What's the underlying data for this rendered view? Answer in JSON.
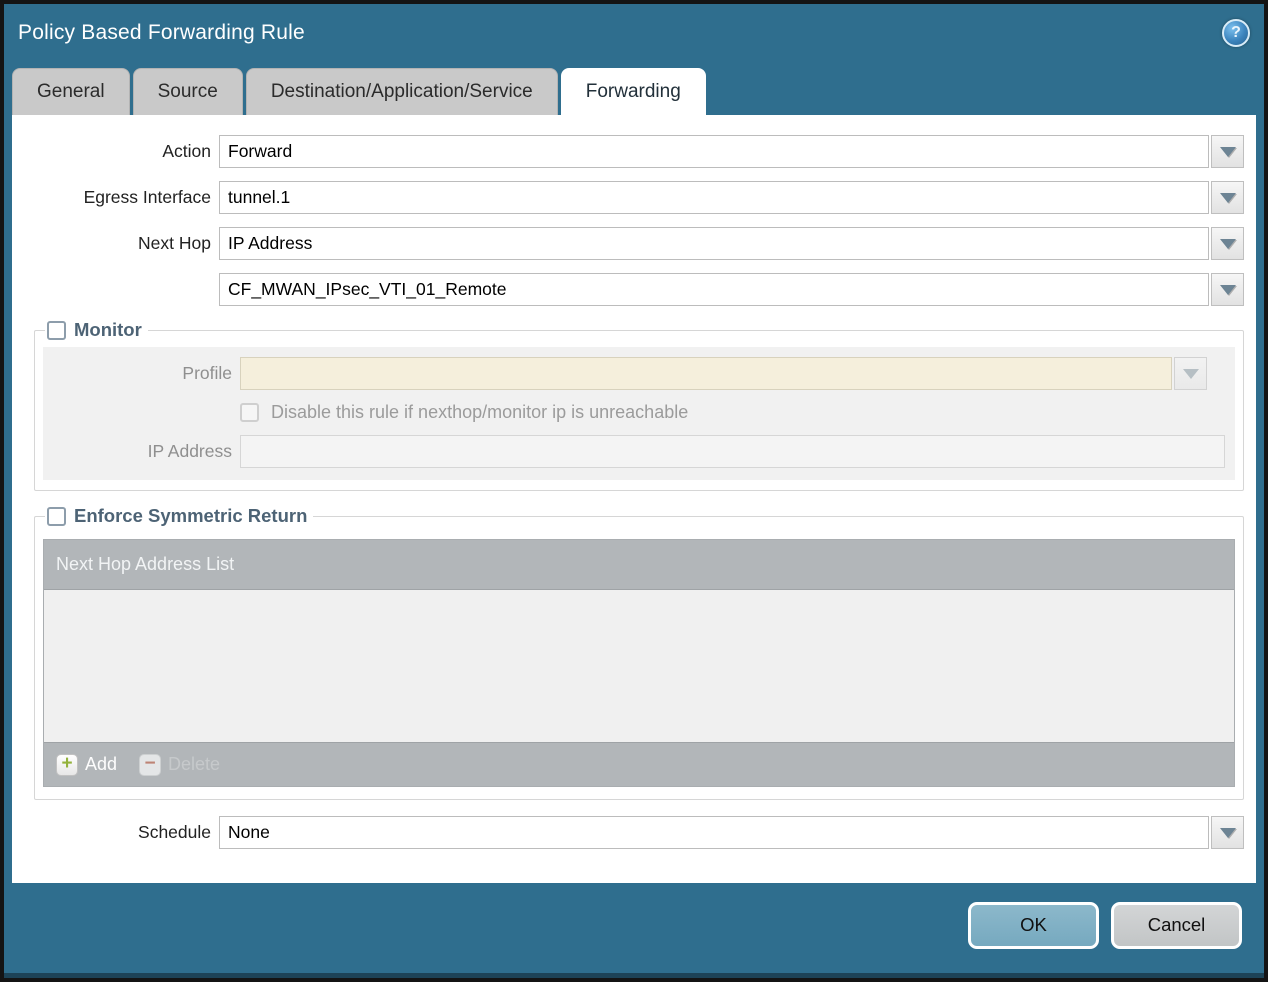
{
  "dialog": {
    "title": "Policy Based Forwarding Rule",
    "help_icon": "?"
  },
  "tabs": [
    {
      "label": "General",
      "active": false
    },
    {
      "label": "Source",
      "active": false
    },
    {
      "label": "Destination/Application/Service",
      "active": false
    },
    {
      "label": "Forwarding",
      "active": true
    }
  ],
  "form": {
    "action": {
      "label": "Action",
      "value": "Forward"
    },
    "egress_interface": {
      "label": "Egress Interface",
      "value": "tunnel.1"
    },
    "next_hop": {
      "label": "Next Hop",
      "type_value": "IP Address",
      "address_value": "CF_MWAN_IPsec_VTI_01_Remote"
    },
    "schedule": {
      "label": "Schedule",
      "value": "None"
    }
  },
  "monitor": {
    "legend": "Monitor",
    "checked": false,
    "profile": {
      "label": "Profile",
      "value": ""
    },
    "disable_rule_checkbox": {
      "label": "Disable this rule if nexthop/monitor ip is unreachable",
      "checked": false
    },
    "ip_address": {
      "label": "IP Address",
      "value": ""
    }
  },
  "enforce_symmetric_return": {
    "legend": "Enforce Symmetric Return",
    "checked": false,
    "table": {
      "header": "Next Hop Address List",
      "rows": [],
      "add_label": "Add",
      "delete_label": "Delete"
    }
  },
  "footer": {
    "ok_label": "OK",
    "cancel_label": "Cancel"
  },
  "colors": {
    "chrome_teal": "#2f6e8e",
    "tab_inactive": "#c9c9c9",
    "table_gray": "#b2b6b9",
    "ok_button": "#7fb0c5",
    "cancel_button": "#c9cccd",
    "profile_disabled_bg": "#f5efdc",
    "legend_text": "#4d6375",
    "add_plus_green": "#93b23c",
    "delete_minus_red": "#bd8374"
  }
}
